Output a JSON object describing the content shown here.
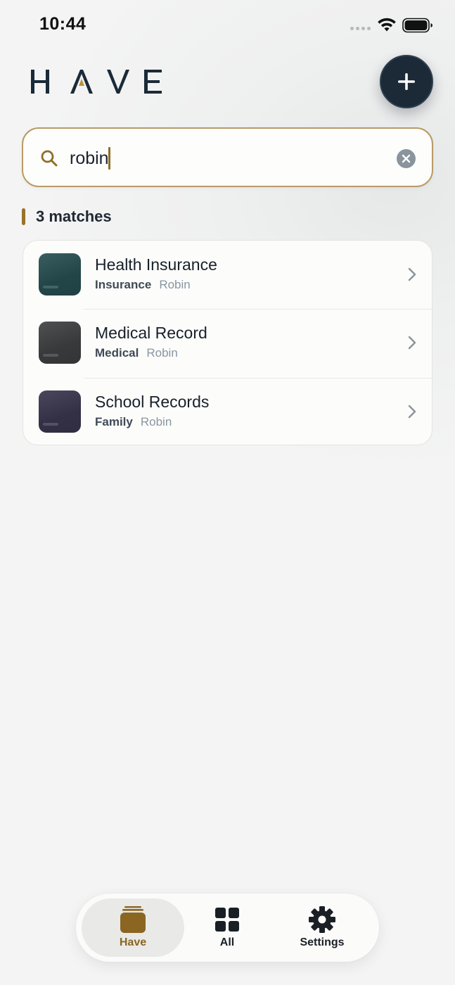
{
  "status_bar": {
    "time": "10:44"
  },
  "header": {
    "logo_letters": [
      "H",
      "A",
      "V",
      "E"
    ],
    "logo_accent_color": "#b8933a",
    "add_button_icon": "plus-icon"
  },
  "search": {
    "value": "robin",
    "icon": "search-icon",
    "clear_icon": "clear-icon"
  },
  "results": {
    "count_label": "3 matches",
    "items": [
      {
        "title": "Health Insurance",
        "category": "Insurance",
        "owner": "Robin",
        "thumb_color": "#244a4c"
      },
      {
        "title": "Medical Record",
        "category": "Medical",
        "owner": "Robin",
        "thumb_color": "#3a3c3e"
      },
      {
        "title": "School Records",
        "category": "Family",
        "owner": "Robin",
        "thumb_color": "#36334a"
      }
    ]
  },
  "tab_bar": {
    "tabs": [
      {
        "label": "Have",
        "icon": "stack-icon",
        "active": true
      },
      {
        "label": "All",
        "icon": "grid-icon",
        "active": false
      },
      {
        "label": "Settings",
        "icon": "gear-icon",
        "active": false
      }
    ]
  },
  "colors": {
    "accent": "#9a7329",
    "navy": "#1c2a38",
    "background": "#f4f4f4"
  }
}
